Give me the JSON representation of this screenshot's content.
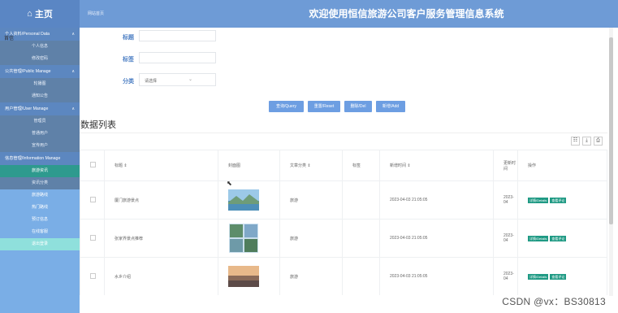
{
  "header": {
    "home_icon": "home-icon",
    "home_label": "主页",
    "breadcrumb": "网站首页",
    "app_title": "欢迎使用恒信旅游公司客户服务管理信息系统"
  },
  "sidebar": {
    "overlay_text": "首信",
    "groups": [
      {
        "label": "个人资料/Personal Data",
        "items": [
          "个人信息",
          "修改密码"
        ]
      },
      {
        "label": "公共管理/Public Manage",
        "items": [
          "轮播图",
          "通知公告"
        ]
      },
      {
        "label": "用户管理/User Manage",
        "items": [
          "管理员",
          "普通用户",
          "宣传用户"
        ]
      },
      {
        "label": "信息管理/Information Manage",
        "items": [
          "旅游资讯",
          "资讯分类",
          "旅游路线",
          "热门路线",
          "预订信息",
          "在线客服",
          "退出登录"
        ]
      }
    ]
  },
  "search": {
    "title_label": "标题",
    "tag_label": "标签",
    "category_label": "分类",
    "category_placeholder": "请选择"
  },
  "buttons": {
    "query": "查询/Query",
    "reset": "重置/Reset",
    "delete": "删除/Del",
    "add": "新增/Add"
  },
  "list": {
    "title": "数据列表",
    "columns": [
      "标题 ⇕",
      "封面图",
      "文章分类 ⇕",
      "标签",
      "新增时间 ⇕",
      "更新时间",
      "操作"
    ],
    "rows": [
      {
        "title": "厦门旅游景点",
        "category": "旅游",
        "tag": "",
        "created": "2023-04-03 21:05:05",
        "updated": "2023-04",
        "thumb": "coast"
      },
      {
        "title": "张家界景点推荐",
        "category": "旅游",
        "tag": "",
        "created": "2023-04-03 21:05:05",
        "updated": "2023-04",
        "thumb": "mountain"
      },
      {
        "title": "水乡介绍",
        "category": "旅游",
        "tag": "",
        "created": "2023-04-03 21:05:05",
        "updated": "2023-04",
        "thumb": "sunset"
      }
    ],
    "detail_label": "详情/Details",
    "comment_label": "查看评论",
    "toolbar_icons": [
      "columns-icon",
      "print-icon",
      "export-icon"
    ]
  },
  "watermark": "CSDN @vx：BS30813"
}
